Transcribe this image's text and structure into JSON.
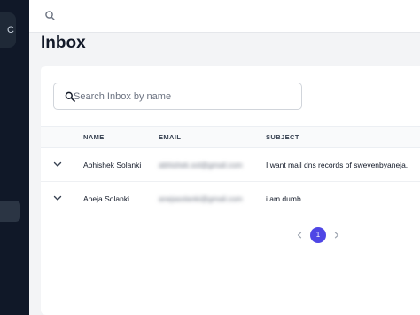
{
  "sidebar": {
    "brand_letter": "C"
  },
  "topbar": {
    "search_icon": "search-icon"
  },
  "page": {
    "title": "Inbox"
  },
  "search": {
    "placeholder": "Search Inbox by name",
    "value": ""
  },
  "table": {
    "columns": [
      "NAME",
      "EMAIL",
      "SUBJECT"
    ],
    "rows": [
      {
        "name": "Abhishek Solanki",
        "email": "abhishek.sol@gmail.com",
        "subject": "I want mail dns records of swevenbyaneja."
      },
      {
        "name": "Aneja Solanki",
        "email": "anejasolanki@gmail.com",
        "subject": "i am dumb"
      }
    ]
  },
  "pagination": {
    "current_page": "1"
  },
  "colors": {
    "sidebar_bg": "#101828",
    "accent": "#4f46e5",
    "page_bg": "#f3f4f6"
  }
}
